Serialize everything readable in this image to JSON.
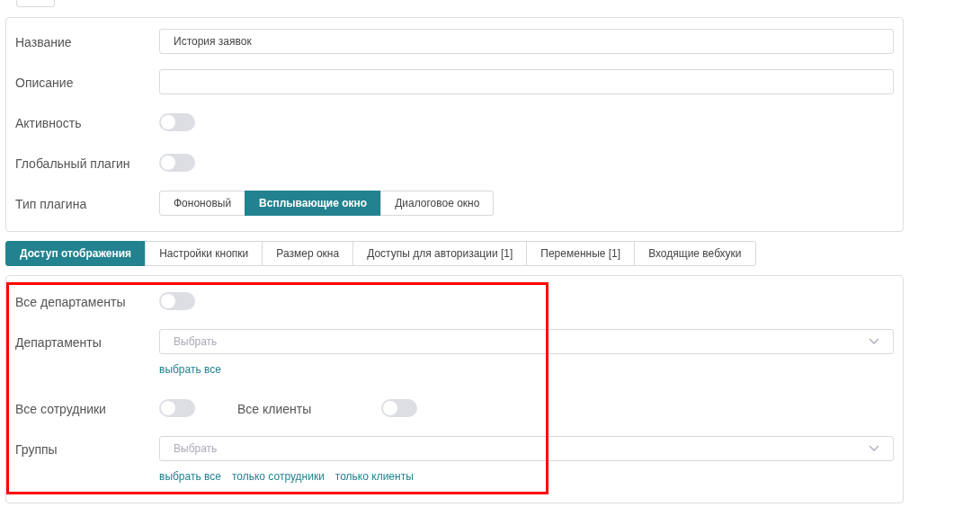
{
  "top_button": {
    "visible": true
  },
  "settings": [
    {
      "kind": "text",
      "label": "Название",
      "value": "История заявок"
    },
    {
      "kind": "text",
      "label": "Описание"
    },
    {
      "kind": "toggle",
      "label": "Активность",
      "on": false
    },
    {
      "kind": "toggle",
      "label": "Глобальный плагин",
      "on": false
    },
    {
      "kind": "segments",
      "label": "Тип плагина",
      "options": [
        {
          "label": "Фононовый",
          "selected": false
        },
        {
          "label": "Всплывающие окно",
          "selected": true
        },
        {
          "label": "Диалоговое окно",
          "selected": false
        }
      ]
    }
  ],
  "tabs": [
    {
      "label": "Доступ отображения",
      "selected": true
    },
    {
      "label": "Настройки кнопки",
      "selected": false
    },
    {
      "label": "Размер окна",
      "selected": false
    },
    {
      "label": "Доступы для авторизации [1]",
      "selected": false
    },
    {
      "label": "Переменные [1]",
      "selected": false
    },
    {
      "label": "Входящие вебхуки",
      "selected": false
    }
  ],
  "access": [
    {
      "kind": "toggle",
      "label": "Все департаменты",
      "on": false
    },
    {
      "kind": "select",
      "label": "Департаменты",
      "placeholder": "Выбрать",
      "links": [
        "выбрать все"
      ]
    },
    {
      "kind": "toggle_pair",
      "label": "Все сотрудники",
      "on": false,
      "second_label": "Все клиенты",
      "second_on": false
    },
    {
      "kind": "select",
      "label": "Группы",
      "placeholder": "Выбрать",
      "links": [
        "выбрать все",
        "только сотрудники",
        "только клиенты"
      ]
    }
  ],
  "highlight_frame": true
}
